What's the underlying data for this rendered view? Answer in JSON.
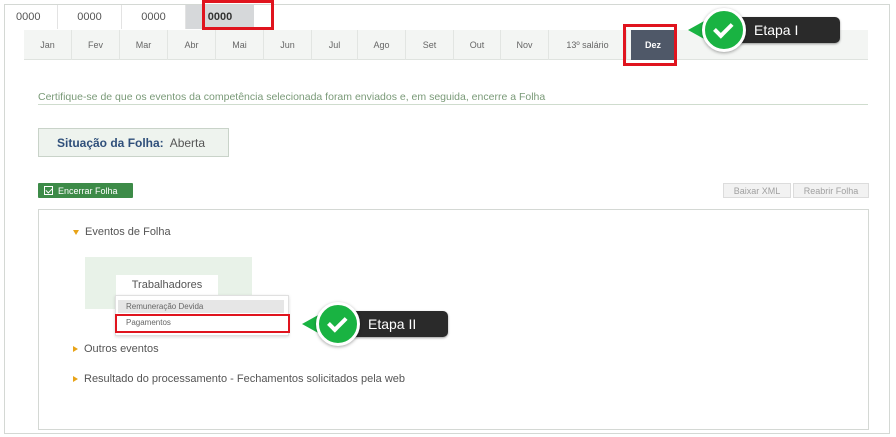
{
  "years": [
    "0000",
    "0000",
    "0000",
    "0000"
  ],
  "years_active_index": 3,
  "months": [
    "Jan",
    "Fev",
    "Mar",
    "Abr",
    "Mai",
    "Jun",
    "Jul",
    "Ago",
    "Set",
    "Out",
    "Nov",
    "13º salário",
    "Dez"
  ],
  "months_active_index": 12,
  "instruction": "Certifique-se de que os eventos da competência selecionada foram enviados e, em seguida, encerre a Folha",
  "situacao": {
    "label": "Situação da Folha:",
    "value": "Aberta"
  },
  "buttons": {
    "encerrar": "Encerrar Folha",
    "baixar_xml": "Baixar XML",
    "reabrir": "Reabrir Folha"
  },
  "tree": {
    "eventos": "Eventos de Folha",
    "trabalhadores_tab": "Trabalhadores",
    "dropdown": [
      "Remuneração Devida",
      "Pagamentos"
    ],
    "outros": "Outros eventos",
    "resultado": "Resultado do processamento - Fechamentos solicitados pela web"
  },
  "callouts": {
    "etapa1": "Etapa I",
    "etapa2": "Etapa II"
  },
  "colors": {
    "highlight": "#e0141e",
    "callout_green": "#19b342",
    "active_month": "#4f5868",
    "encerrar_green": "#3d8b48"
  }
}
